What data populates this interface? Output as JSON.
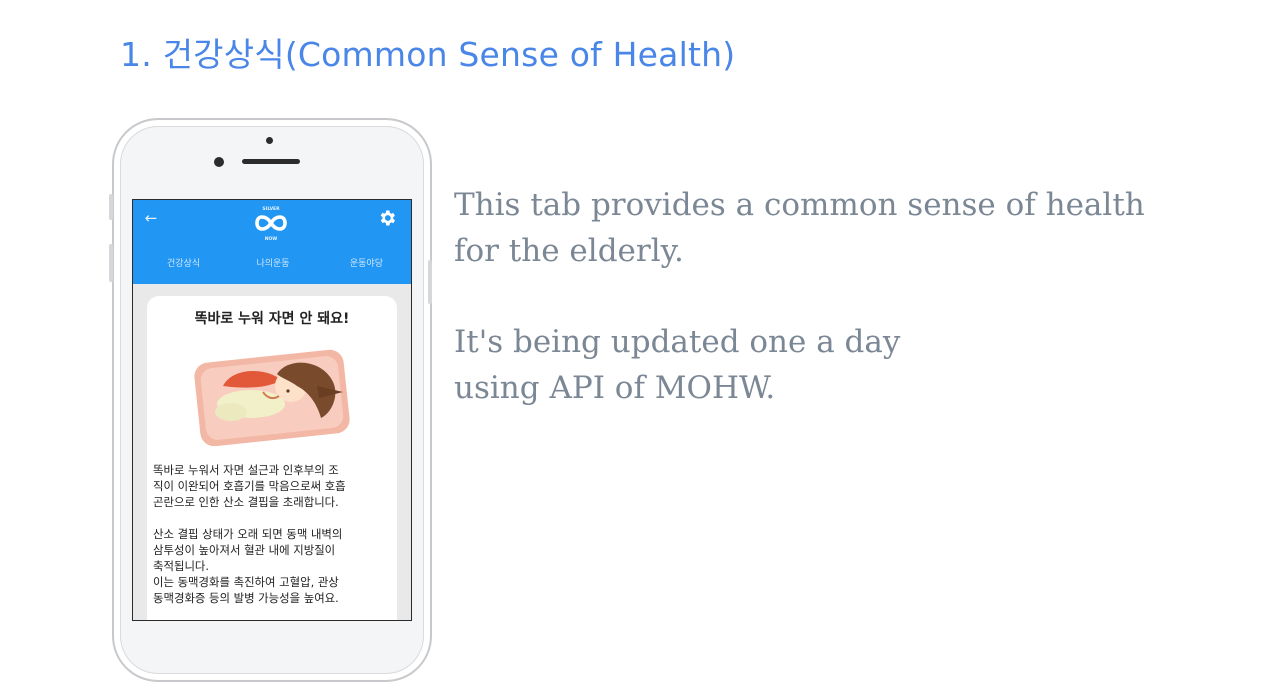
{
  "slide": {
    "title": "1. 건강상식(Common Sense of Health)",
    "description": [
      "This tab provides a common sense of health\nfor the elderly.",
      "It's being updated one a day\nusing API of MOHW."
    ]
  },
  "app": {
    "logo_icon": "silver-infinity-logo-icon",
    "back_icon": "arrow-left-icon",
    "settings_icon": "gear-icon",
    "tabs": [
      {
        "label": "건강상식"
      },
      {
        "label": "나의운동"
      },
      {
        "label": "운동야당"
      }
    ],
    "article": {
      "title": "똑바로 누워 자면 안 돼요!",
      "image_icon": "sleeping-person-illustration",
      "paragraphs": [
        "똑바로 누워서 자면 설근과 인후부의 조\n직이 이완되어 호흡기를 막음으로써 호흡\n곤란으로 인한 산소 결핍을 초래합니다.",
        "산소 결핍 상태가 오래 되면 동맥 내벽의\n삼투성이 높아져서 혈관 내에 지방질이\n축적됩니다.\n이는 동맥경화를 촉진하여 고혈압, 관상\n동맥경화증 등의 발병 가능성을 높여요."
      ]
    }
  },
  "colors": {
    "title_blue": "#4a86e8",
    "app_bar_blue": "#2196f3",
    "description_gray": "#7b8794"
  }
}
